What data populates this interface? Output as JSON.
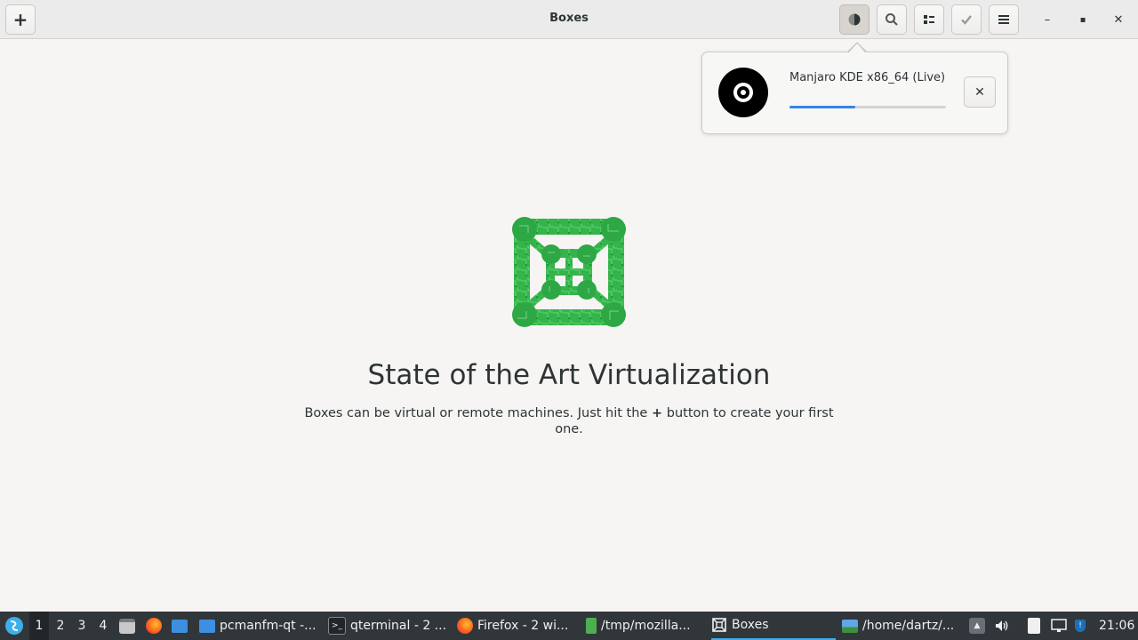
{
  "window": {
    "title": "Boxes"
  },
  "header": {
    "new_icon": "plus-icon",
    "downloads_icon": "downloads-pie-icon",
    "search_icon": "search-icon",
    "view_icon": "view-toggle-icon",
    "select_icon": "checkmark-icon",
    "menu_icon": "hamburger-menu-icon",
    "minimize_glyph": "–",
    "maximize_glyph": "▪",
    "close_glyph": "✕"
  },
  "download_popover": {
    "name": "Manjaro KDE x86_64 (Live)",
    "progress": 0.42,
    "close_glyph": "✕"
  },
  "empty_state": {
    "title": "State of the Art Virtualization",
    "description_before": "Boxes can be virtual or remote machines. Just hit the ",
    "description_plus": "+",
    "description_after": " button to create your first one."
  },
  "taskbar": {
    "workspaces": [
      "1",
      "2",
      "3",
      "4"
    ],
    "active_workspace": "1",
    "tasks": [
      {
        "label": "pcmanfm-qt -...",
        "icon": "folder-icon"
      },
      {
        "label": "qterminal - 2 ...",
        "icon": "terminal-icon"
      },
      {
        "label": "Firefox - 2 wi...",
        "icon": "firefox-icon"
      },
      {
        "label": "/tmp/mozilla...",
        "icon": "archive-icon"
      },
      {
        "label": "Boxes",
        "icon": "boxes-icon"
      },
      {
        "label": "/home/dartz/...",
        "icon": "image-viewer-icon"
      }
    ],
    "clock": "21:06"
  },
  "colors": {
    "accent": "#3584e4",
    "logo_green": "#33b54a",
    "taskbar_bg": "#31363b",
    "taskbar_accent": "#3daee9"
  }
}
